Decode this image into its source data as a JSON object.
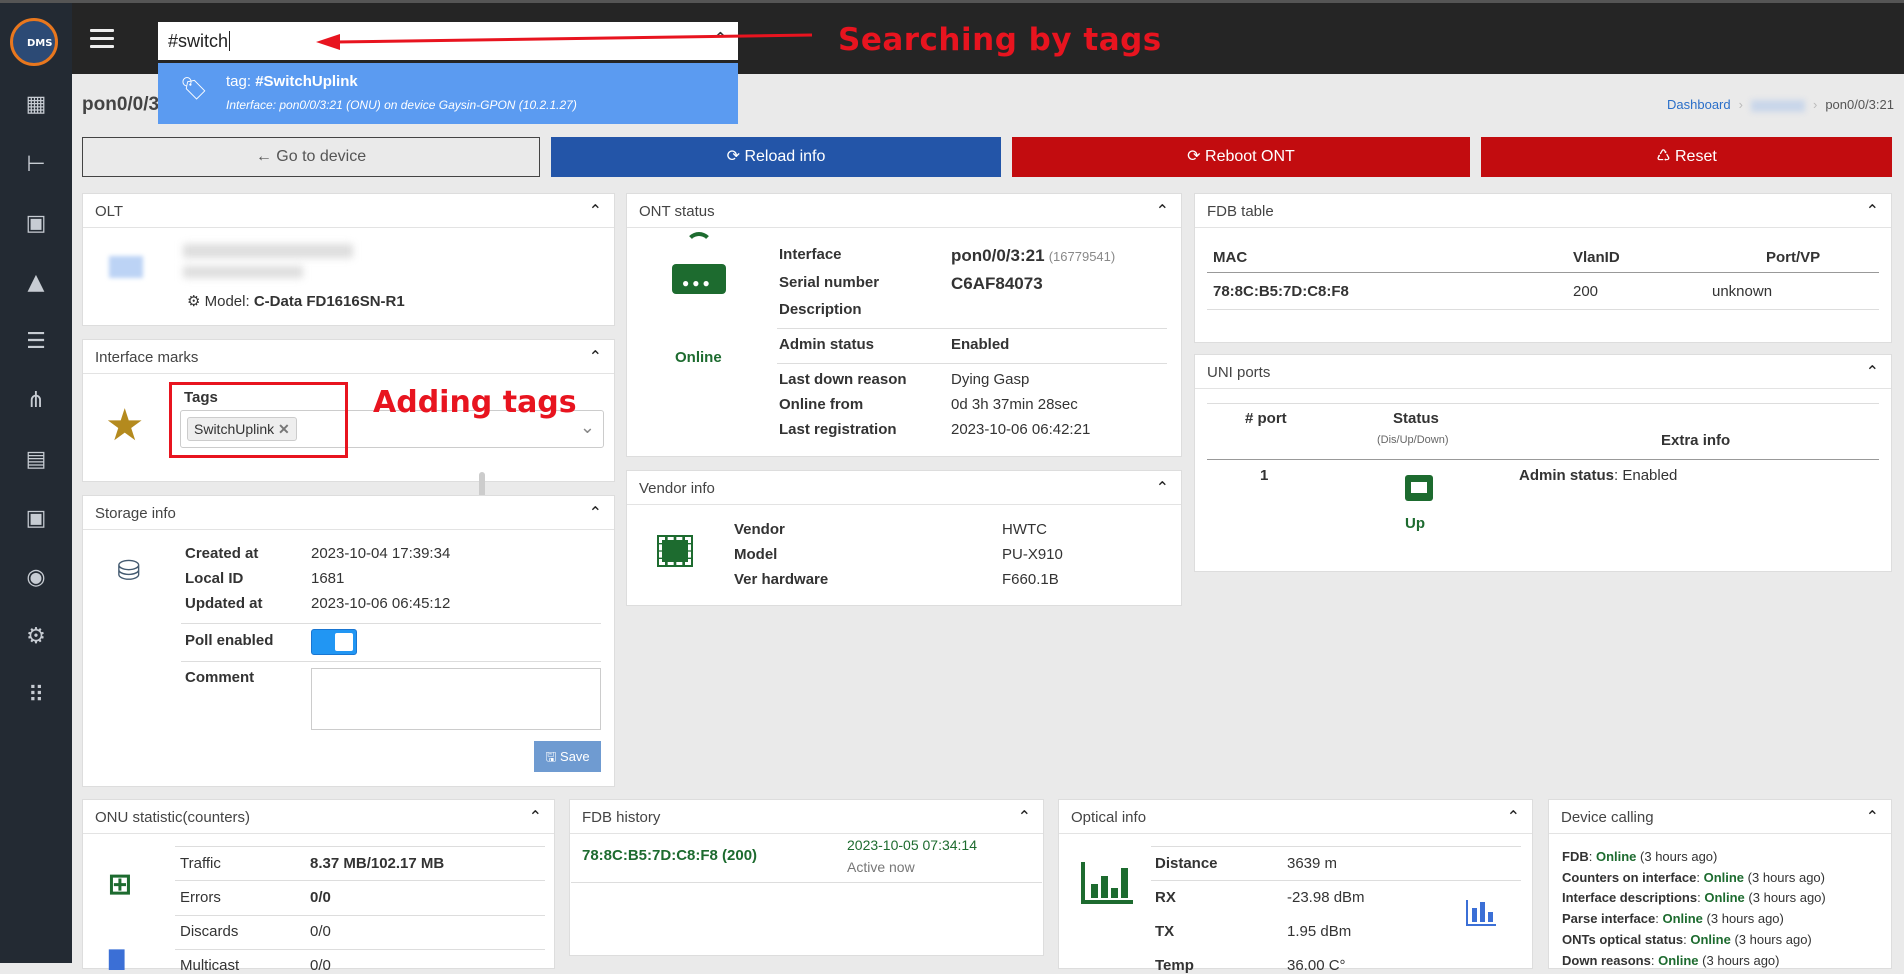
{
  "app": {
    "logo_text": "DMS"
  },
  "sidebar": {
    "items": [
      {
        "icon": "dashboard-icon"
      },
      {
        "icon": "tree-icon"
      },
      {
        "icon": "device-icon"
      },
      {
        "icon": "alert-icon"
      },
      {
        "icon": "log-search-icon"
      },
      {
        "icon": "topology-icon"
      },
      {
        "icon": "document-icon"
      },
      {
        "icon": "image-icon"
      },
      {
        "icon": "users-icon"
      },
      {
        "icon": "settings-icon"
      },
      {
        "icon": "apps-icon"
      }
    ]
  },
  "search": {
    "value": "#switch",
    "result_prefix": "tag: ",
    "result_tag": "#SwitchUplink",
    "result_detail": "Interface: pon0/0/3:21 (ONU) on device Gaysin-GPON (10.2.1.27)"
  },
  "annotations": {
    "search": "Searching by tags",
    "tags": "Adding tags"
  },
  "page": {
    "title": "pon0/0/3"
  },
  "breadcrumb": {
    "dashboard": "Dashboard",
    "current": "pon0/0/3:21"
  },
  "actions": {
    "goto": "← Go to device",
    "reload": "⟳ Reload info",
    "reboot": "⟳ Reboot ONT",
    "reset": "♺ Reset"
  },
  "olt": {
    "title": "OLT",
    "model_label": "Model:",
    "model_value": "C-Data FD1616SN-R1"
  },
  "marks": {
    "title": "Interface marks",
    "tags_label": "Tags",
    "tag": "SwitchUplink"
  },
  "storage": {
    "title": "Storage info",
    "created_label": "Created at",
    "created": "2023-10-04 17:39:34",
    "local_id_label": "Local ID",
    "local_id": "1681",
    "updated_label": "Updated at",
    "updated": "2023-10-06 06:45:12",
    "poll_label": "Poll enabled",
    "poll_enabled": true,
    "comment_label": "Comment",
    "save": "Save"
  },
  "ont": {
    "title": "ONT status",
    "state": "Online",
    "interface_label": "Interface",
    "interface": "pon0/0/3:21",
    "interface_index": "(16779541)",
    "serial_label": "Serial number",
    "serial": "C6AF84073",
    "desc_label": "Description",
    "admin_label": "Admin status",
    "admin": "Enabled",
    "down_label": "Last down reason",
    "down": "Dying Gasp",
    "online_from_label": "Online from",
    "online_from": "0d 3h 37min 28sec",
    "last_reg_label": "Last registration",
    "last_reg": "2023-10-06 06:42:21"
  },
  "vendor": {
    "title": "Vendor info",
    "vendor_label": "Vendor",
    "vendor": "HWTC",
    "model_label": "Model",
    "model": "PU-X910",
    "hw_label": "Ver hardware",
    "hw": "F660.1B"
  },
  "fdb": {
    "title": "FDB table",
    "headers": [
      "MAC",
      "VlanID",
      "Port/VP"
    ],
    "row": {
      "mac": "78:8C:B5:7D:C8:F8",
      "vlan": "200",
      "port": "unknown"
    }
  },
  "uni": {
    "title": "UNI ports",
    "h_port": "# port",
    "h_status": "Status",
    "h_status_sub": "(Dis/Up/Down)",
    "h_extra": "Extra info",
    "port": "1",
    "status": "Up",
    "extra_label": "Admin status",
    "extra_value": ": Enabled"
  },
  "onu_stat": {
    "title": "ONU statistic(counters)",
    "traffic_label": "Traffic",
    "traffic": "8.37 MB/102.17 MB",
    "errors_label": "Errors",
    "errors": "0/0",
    "discards_label": "Discards",
    "discards": "0/0",
    "multicast_label": "Multicast",
    "multicast": "0/0"
  },
  "fdb_history": {
    "title": "FDB history",
    "mac": "78:8C:B5:7D:C8:F8 (200)",
    "time": "2023-10-05 07:34:14",
    "state": "Active now"
  },
  "optical": {
    "title": "Optical info",
    "distance_label": "Distance",
    "distance": "3639 m",
    "rx_label": "RX",
    "rx": "-23.98 dBm",
    "tx_label": "TX",
    "tx": "1.95 dBm",
    "temp_label": "Temp",
    "temp": "36.00 C°"
  },
  "device_calling": {
    "title": "Device calling",
    "items": [
      {
        "name": "FDB",
        "status": "Online",
        "ago": "(3 hours ago)"
      },
      {
        "name": "Counters on interface",
        "status": "Online",
        "ago": "(3 hours ago)"
      },
      {
        "name": "Interface descriptions",
        "status": "Online",
        "ago": "(3 hours ago)"
      },
      {
        "name": "Parse interface",
        "status": "Online",
        "ago": "(3 hours ago)"
      },
      {
        "name": "ONTs optical status",
        "status": "Online",
        "ago": "(3 hours ago)"
      },
      {
        "name": "Down reasons",
        "status": "Online",
        "ago": "(3 hours ago)"
      }
    ]
  },
  "colors": {
    "accent_blue": "#2355a8",
    "danger": "#c20c0f",
    "online": "#1d6b2f",
    "annotation": "#e8141f"
  }
}
